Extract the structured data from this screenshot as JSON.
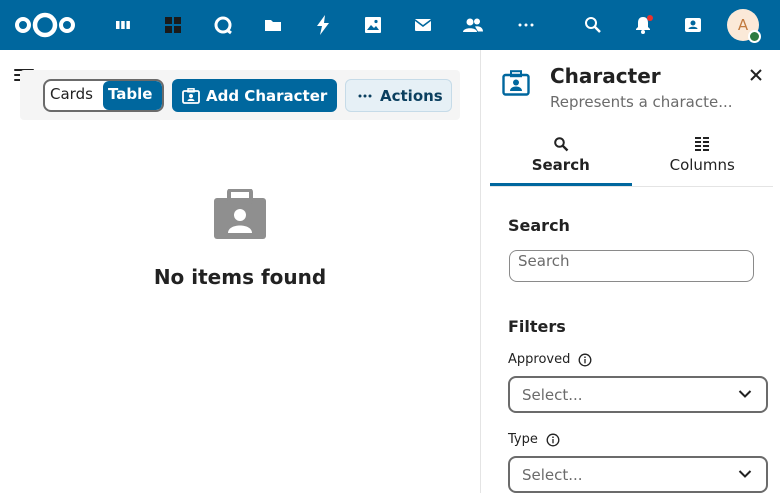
{
  "topbar": {
    "apps": [
      {
        "name": "deck-icon"
      },
      {
        "name": "dashboard-icon"
      },
      {
        "name": "talk-icon"
      },
      {
        "name": "files-icon"
      },
      {
        "name": "activity-icon"
      },
      {
        "name": "photos-icon"
      },
      {
        "name": "mail-icon"
      },
      {
        "name": "contacts-icon"
      },
      {
        "name": "more-apps-icon"
      }
    ],
    "avatar_initial": "A",
    "brand_color": "#00679e"
  },
  "toolbar": {
    "view_cards": "Cards",
    "view_table": "Table",
    "add_label": "Add Character",
    "actions_label": "Actions"
  },
  "empty_state": {
    "text": "No items found"
  },
  "sidebar": {
    "title": "Character",
    "subtitle": "Represents a characte...",
    "tabs": [
      {
        "label": "Search",
        "active": true
      },
      {
        "label": "Columns",
        "active": false
      }
    ],
    "search_heading": "Search",
    "search_placeholder": "Search",
    "filters_heading": "Filters",
    "filters": [
      {
        "label": "Approved",
        "placeholder": "Select..."
      },
      {
        "label": "Type",
        "placeholder": "Select..."
      }
    ]
  }
}
